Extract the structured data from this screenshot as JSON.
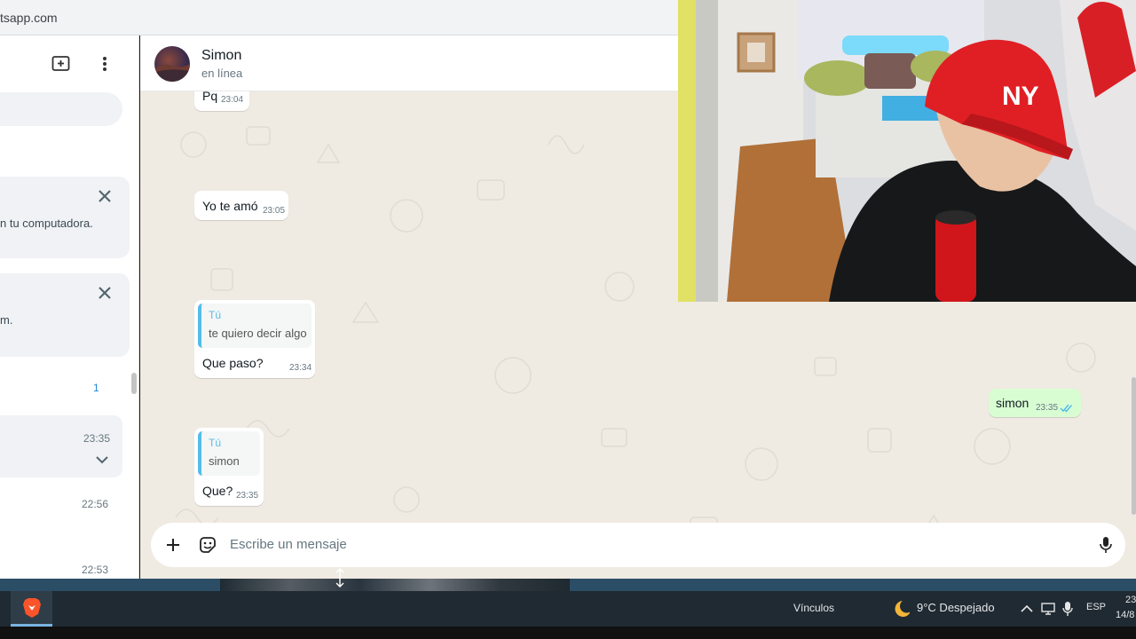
{
  "browser": {
    "url_fragment": "tsapp.com"
  },
  "sidebar": {
    "banner1_text": "n tu computadora.",
    "banner2_text": "m.",
    "unread_count": "1",
    "times": [
      "23:35",
      "22:56",
      "22:53"
    ]
  },
  "chat": {
    "contact_name": "Simon",
    "contact_status": "en línea",
    "messages": [
      {
        "text": "Pq",
        "time": "23:04"
      },
      {
        "text": "Yo te amó",
        "time": "23:05"
      },
      {
        "quote_author": "Tú",
        "quote_text": "te quiero decir algo",
        "text": "Que paso?",
        "time": "23:34"
      },
      {
        "text": "simon",
        "time": "23:35"
      },
      {
        "quote_author": "Tú",
        "quote_text": "simon",
        "text": "Que?",
        "time": "23:35"
      }
    ],
    "composer_placeholder": "Escribe un mensaje"
  },
  "taskbar": {
    "links_label": "Vínculos",
    "weather": "9°C  Despejado",
    "language": "ESP",
    "clock_time": "23",
    "clock_date": "14/8"
  },
  "colors": {
    "outgoing_bubble": "#d9fdd3",
    "chat_background": "#efeae2",
    "quote_accent": "#53bdeb",
    "read_ticks": "#53bdeb"
  }
}
